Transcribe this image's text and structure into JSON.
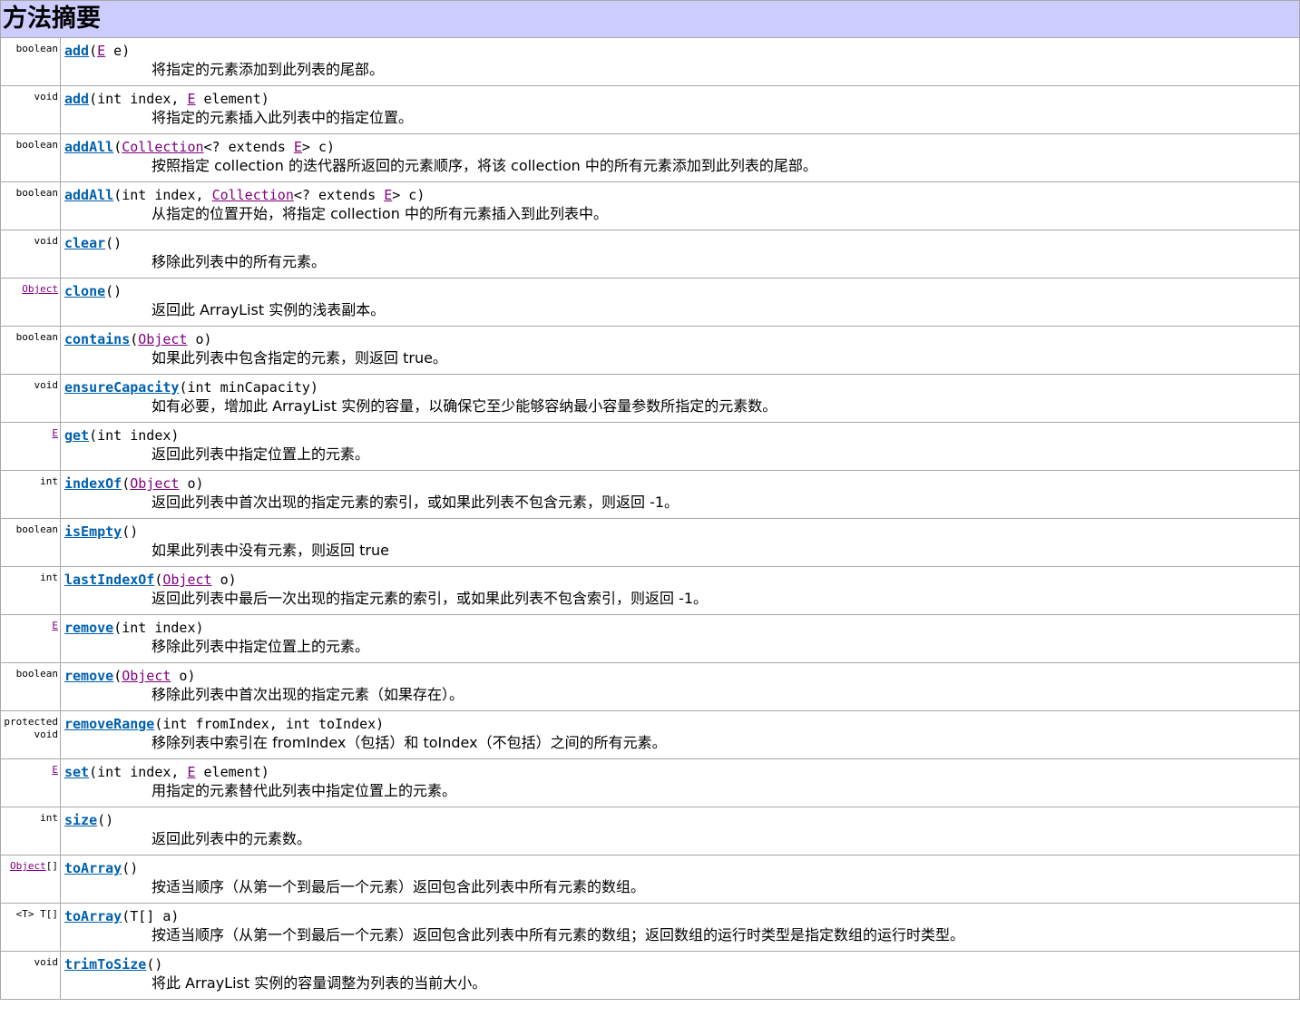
{
  "header": {
    "title": "方法摘要"
  },
  "methods": [
    {
      "type": [
        {
          "t": "boolean"
        }
      ],
      "name": "add",
      "params": [
        {
          "t": "("
        },
        {
          "t": "E",
          "link": true
        },
        {
          "t": " e)"
        }
      ],
      "desc": "将指定的元素添加到此列表的尾部。"
    },
    {
      "type": [
        {
          "t": "void"
        }
      ],
      "name": "add",
      "params": [
        {
          "t": "(int index, "
        },
        {
          "t": "E",
          "link": true
        },
        {
          "t": " element)"
        }
      ],
      "desc": "将指定的元素插入此列表中的指定位置。"
    },
    {
      "type": [
        {
          "t": "boolean"
        }
      ],
      "name": "addAll",
      "params": [
        {
          "t": "("
        },
        {
          "t": "Collection",
          "link": true
        },
        {
          "t": "<? extends "
        },
        {
          "t": "E",
          "link": true
        },
        {
          "t": "> c)"
        }
      ],
      "desc": "按照指定 collection 的迭代器所返回的元素顺序，将该 collection 中的所有元素添加到此列表的尾部。"
    },
    {
      "type": [
        {
          "t": "boolean"
        }
      ],
      "name": "addAll",
      "params": [
        {
          "t": "(int index, "
        },
        {
          "t": "Collection",
          "link": true
        },
        {
          "t": "<? extends "
        },
        {
          "t": "E",
          "link": true
        },
        {
          "t": "> c)"
        }
      ],
      "desc": "从指定的位置开始，将指定 collection 中的所有元素插入到此列表中。"
    },
    {
      "type": [
        {
          "t": "void"
        }
      ],
      "name": "clear",
      "params": [
        {
          "t": "()"
        }
      ],
      "desc": "移除此列表中的所有元素。"
    },
    {
      "type": [
        {
          "t": "Object",
          "link": true
        }
      ],
      "name": "clone",
      "params": [
        {
          "t": "()"
        }
      ],
      "desc": "返回此 ArrayList 实例的浅表副本。"
    },
    {
      "type": [
        {
          "t": "boolean"
        }
      ],
      "name": "contains",
      "params": [
        {
          "t": "("
        },
        {
          "t": "Object",
          "link": true
        },
        {
          "t": " o)"
        }
      ],
      "desc": "如果此列表中包含指定的元素，则返回 true。"
    },
    {
      "type": [
        {
          "t": "void"
        }
      ],
      "name": "ensureCapacity",
      "params": [
        {
          "t": "(int minCapacity)"
        }
      ],
      "desc": "如有必要，增加此 ArrayList 实例的容量，以确保它至少能够容纳最小容量参数所指定的元素数。"
    },
    {
      "type": [
        {
          "t": "E",
          "link": true
        }
      ],
      "name": "get",
      "params": [
        {
          "t": "(int index)"
        }
      ],
      "desc": "返回此列表中指定位置上的元素。"
    },
    {
      "type": [
        {
          "t": "int"
        }
      ],
      "name": "indexOf",
      "params": [
        {
          "t": "("
        },
        {
          "t": "Object",
          "link": true
        },
        {
          "t": " o)"
        }
      ],
      "desc": "返回此列表中首次出现的指定元素的索引，或如果此列表不包含元素，则返回 -1。"
    },
    {
      "type": [
        {
          "t": "boolean"
        }
      ],
      "name": "isEmpty",
      "params": [
        {
          "t": "()"
        }
      ],
      "desc": "如果此列表中没有元素，则返回 true"
    },
    {
      "type": [
        {
          "t": "int"
        }
      ],
      "name": "lastIndexOf",
      "params": [
        {
          "t": "("
        },
        {
          "t": "Object",
          "link": true
        },
        {
          "t": " o)"
        }
      ],
      "desc": "返回此列表中最后一次出现的指定元素的索引，或如果此列表不包含索引，则返回 -1。"
    },
    {
      "type": [
        {
          "t": "E",
          "link": true
        }
      ],
      "name": "remove",
      "params": [
        {
          "t": "(int index)"
        }
      ],
      "desc": "移除此列表中指定位置上的元素。"
    },
    {
      "type": [
        {
          "t": "boolean"
        }
      ],
      "name": "remove",
      "params": [
        {
          "t": "("
        },
        {
          "t": "Object",
          "link": true
        },
        {
          "t": " o)"
        }
      ],
      "desc": "移除此列表中首次出现的指定元素（如果存在）。"
    },
    {
      "type": [
        {
          "t": "protected"
        },
        {
          "t": "void",
          "br": true
        }
      ],
      "name": "removeRange",
      "params": [
        {
          "t": "(int fromIndex, int toIndex)"
        }
      ],
      "desc": "移除列表中索引在 fromIndex（包括）和 toIndex（不包括）之间的所有元素。"
    },
    {
      "type": [
        {
          "t": "E",
          "link": true
        }
      ],
      "name": "set",
      "params": [
        {
          "t": "(int index, "
        },
        {
          "t": "E",
          "link": true
        },
        {
          "t": " element)"
        }
      ],
      "desc": "用指定的元素替代此列表中指定位置上的元素。"
    },
    {
      "type": [
        {
          "t": "int"
        }
      ],
      "name": "size",
      "params": [
        {
          "t": "()"
        }
      ],
      "desc": "返回此列表中的元素数。"
    },
    {
      "type": [
        {
          "t": "Object",
          "link": true
        },
        {
          "t": "[]"
        }
      ],
      "name": "toArray",
      "params": [
        {
          "t": "()"
        }
      ],
      "desc": "按适当顺序（从第一个到最后一个元素）返回包含此列表中所有元素的数组。"
    },
    {
      "type": [
        {
          "t": "<T> T[]"
        }
      ],
      "name": "toArray",
      "params": [
        {
          "t": "(T[] a)"
        }
      ],
      "desc": "按适当顺序（从第一个到最后一个元素）返回包含此列表中所有元素的数组；返回数组的运行时类型是指定数组的运行时类型。"
    },
    {
      "type": [
        {
          "t": "void"
        }
      ],
      "name": "trimToSize",
      "params": [
        {
          "t": "()"
        }
      ],
      "desc": "将此 ArrayList 实例的容量调整为列表的当前大小。"
    }
  ]
}
